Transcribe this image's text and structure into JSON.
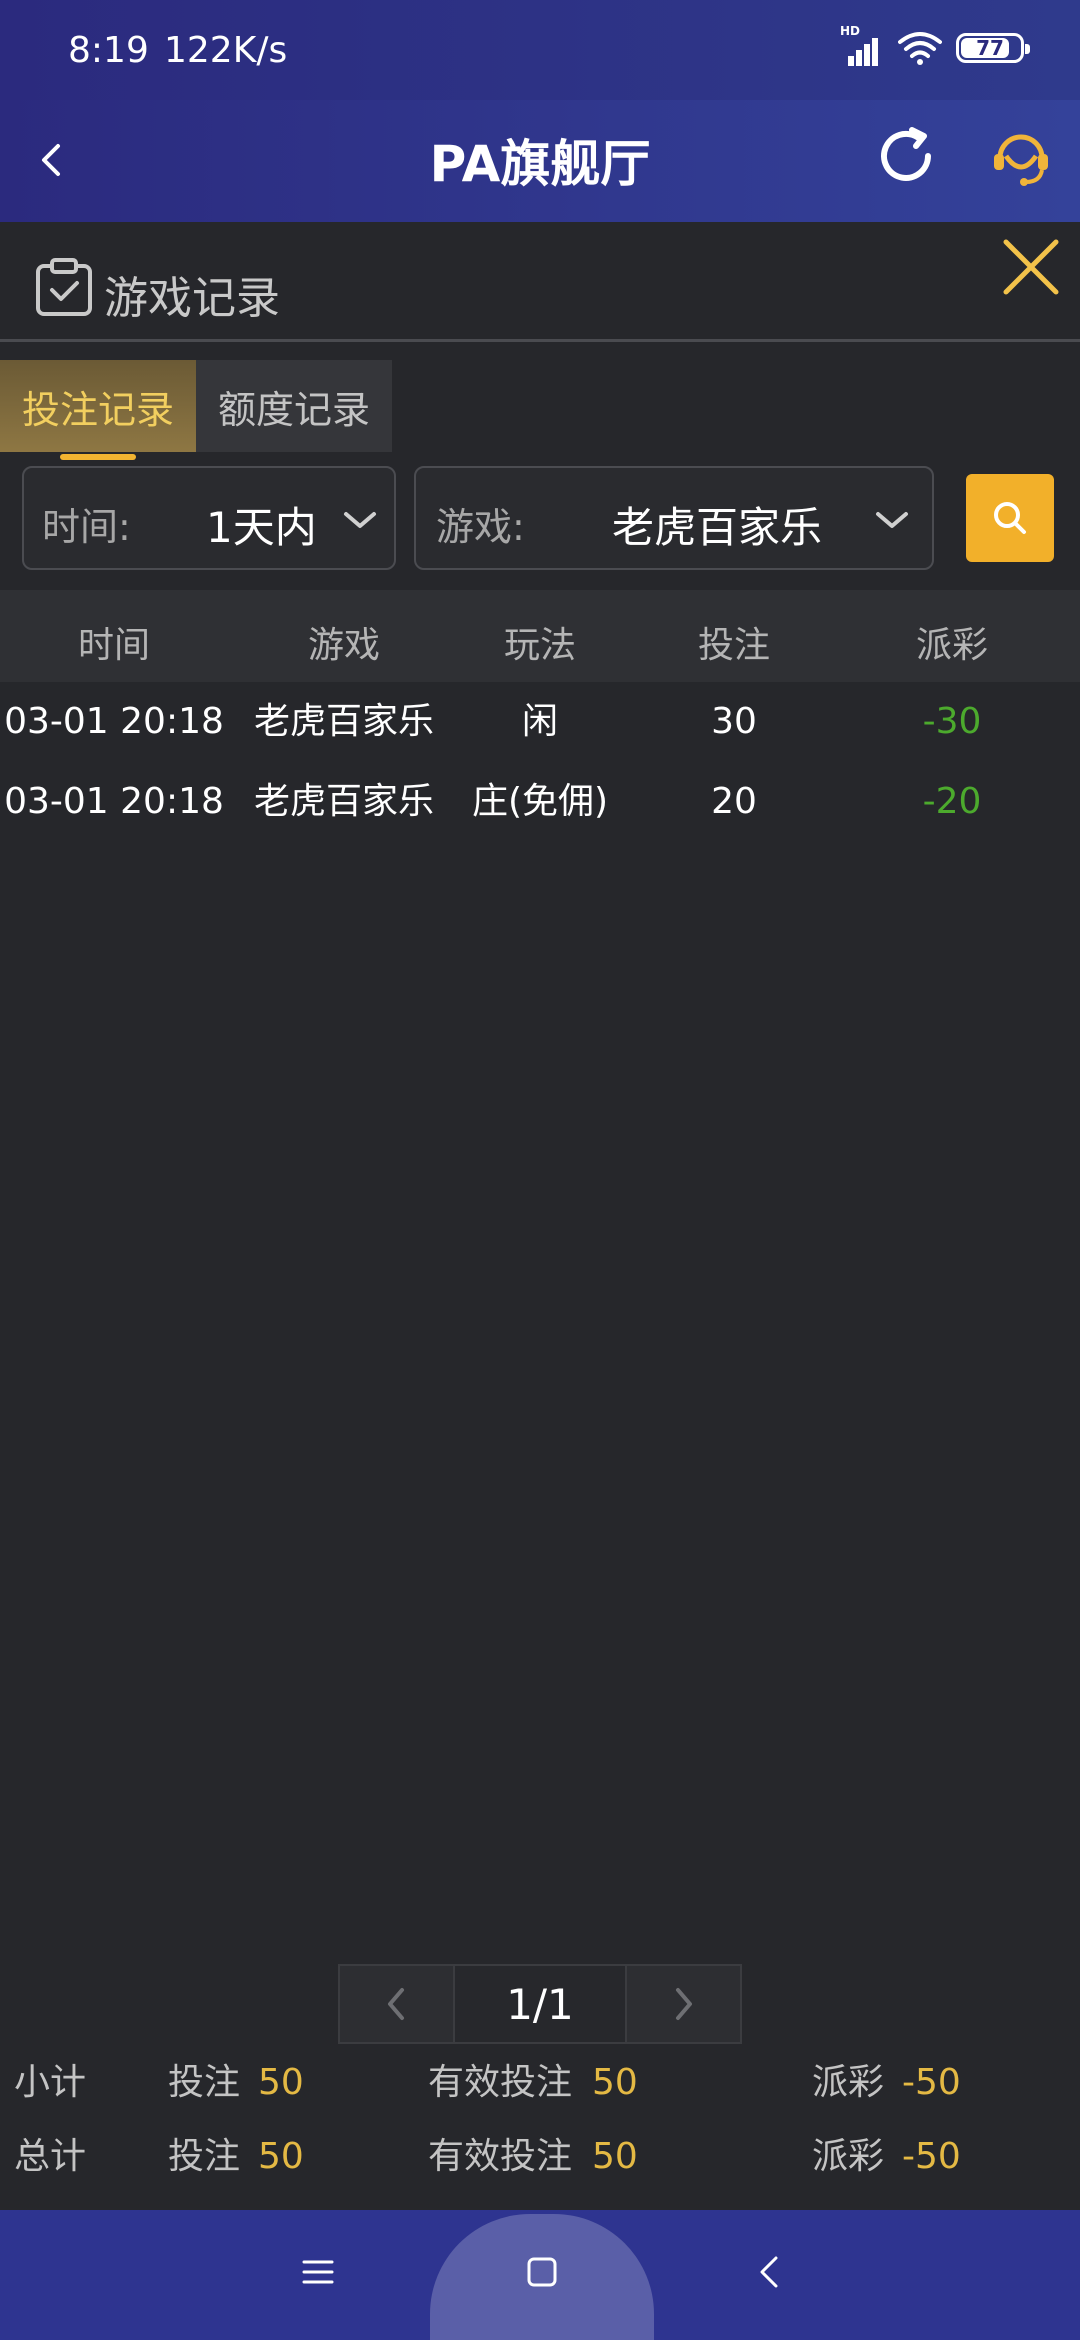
{
  "status_bar": {
    "time": "8:19",
    "speed": "122K/s",
    "signal_badge": "HD",
    "battery": "77"
  },
  "nav": {
    "title": "PA旗舰厅"
  },
  "panel": {
    "title": "游戏记录"
  },
  "tabs": [
    {
      "label": "投注记录",
      "active": true
    },
    {
      "label": "额度记录",
      "active": false
    }
  ],
  "filters": {
    "time_label": "时间:",
    "time_value": "1天内",
    "game_label": "游戏:",
    "game_value": "老虎百家乐"
  },
  "table": {
    "columns": [
      "时间",
      "游戏",
      "玩法",
      "投注",
      "派彩"
    ],
    "rows": [
      {
        "time": "03-01 20:18",
        "game": "老虎百家乐",
        "play": "闲",
        "bet": "30",
        "payout": "-30"
      },
      {
        "time": "03-01 20:18",
        "game": "老虎百家乐",
        "play": "庄(免佣)",
        "bet": "20",
        "payout": "-20"
      }
    ]
  },
  "pagination": {
    "page": "1/1"
  },
  "summary": {
    "subtotal": {
      "label": "小计",
      "bet_label": "投注",
      "bet": "50",
      "valid_label": "有效投注",
      "valid": "50",
      "payout_label": "派彩",
      "payout": "-50"
    },
    "total": {
      "label": "总计",
      "bet_label": "投注",
      "bet": "50",
      "valid_label": "有效投注",
      "valid": "50",
      "payout_label": "派彩",
      "payout": "-50"
    }
  },
  "colors": {
    "accent_gold": "#f2b02a",
    "win_green": "#4caa2d",
    "header_blue": "#2b2a7e"
  }
}
